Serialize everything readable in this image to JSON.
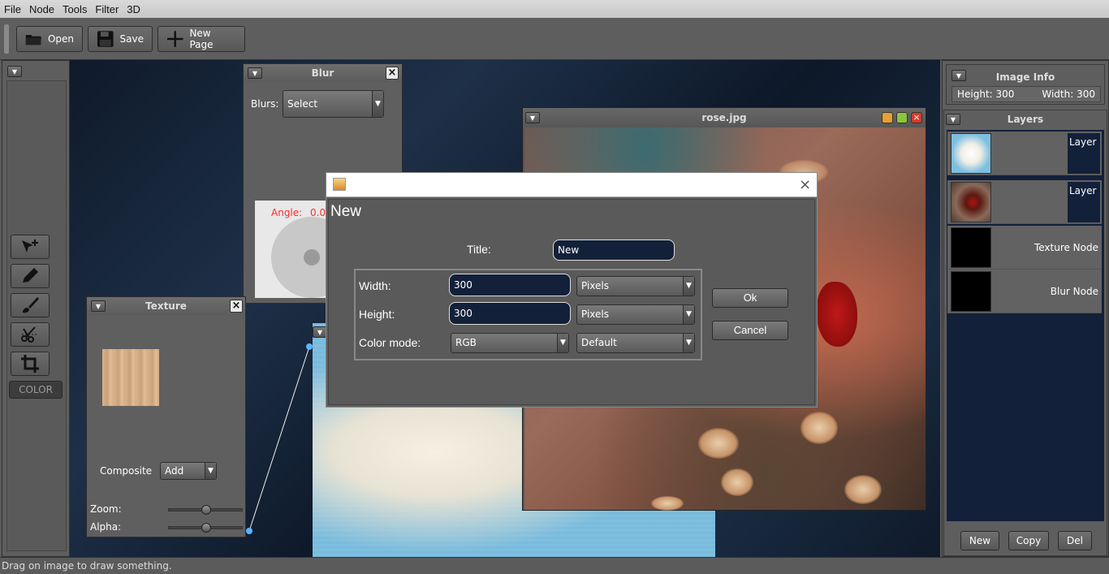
{
  "menubar": {
    "items": [
      "File",
      "Node",
      "Tools",
      "Filter",
      "3D"
    ]
  },
  "toolbar": {
    "open": "Open",
    "save": "Save",
    "new_page": "New Page"
  },
  "tools": {
    "color_label": "COLOR"
  },
  "blur_panel": {
    "title": "Blur",
    "blurs_label": "Blurs:",
    "blurs_value": "Select",
    "angle_label": "Angle:",
    "angle_value": "0.0"
  },
  "texture_panel": {
    "title": "Texture",
    "composite_label": "Composite",
    "composite_value": "Add",
    "zoom_label": "Zoom:",
    "alpha_label": "Alpha:",
    "zoom_level": 0.6,
    "alpha_level": 0.6
  },
  "rose_window": {
    "title": "rose.jpg"
  },
  "dialog": {
    "heading": "New",
    "title_label": "Title:",
    "title_value": "New",
    "width_label": "Width:",
    "width_value": "300",
    "width_unit": "Pixels",
    "height_label": "Height:",
    "height_value": "300",
    "height_unit": "Pixels",
    "color_mode_label": "Color mode:",
    "color_mode_value": "RGB",
    "color_mode_option": "Default",
    "ok": "Ok",
    "cancel": "Cancel"
  },
  "image_info": {
    "title": "Image Info",
    "height": "Height: 300",
    "width": "Width: 300"
  },
  "layers": {
    "title": "Layers",
    "items": [
      {
        "label": "Layer"
      },
      {
        "label": "Layer"
      },
      {
        "label": "Texture Node"
      },
      {
        "label": "Blur Node"
      }
    ],
    "new": "New",
    "copy": "Copy",
    "del": "Del"
  },
  "status": {
    "text": "Drag on image to draw something."
  },
  "colors": {
    "angle_text": "#ff2a2a",
    "desk_bg": "#13203a",
    "field_bg": "#13203a"
  }
}
